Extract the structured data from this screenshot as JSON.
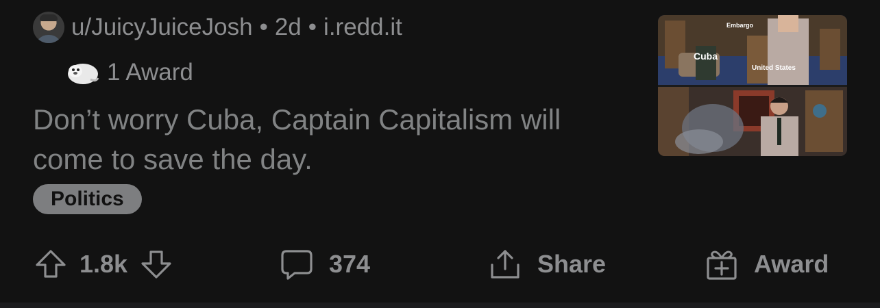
{
  "post": {
    "author": "u/JuicyJuiceJosh",
    "age": "2d",
    "domain": "i.redd.it",
    "separator": "•",
    "awards_label": "1 Award",
    "title": "Don’t worry Cuba, Captain Capitalism will come to save the day.",
    "flair": "Politics",
    "thumbnail": {
      "label_top": "Embargo",
      "label_left": "Cuba",
      "label_right": "United States"
    }
  },
  "actions": {
    "upvotes": "1.8k",
    "comments": "374",
    "share_label": "Share",
    "award_label": "Award"
  },
  "icons": {
    "upvote": "arrow-up-icon",
    "downvote": "arrow-down-icon",
    "comment": "speech-bubble-icon",
    "share": "share-icon",
    "award": "gift-icon",
    "award_badge": "seal-award-icon"
  },
  "colors": {
    "background": "#121212",
    "text": "#818384",
    "flair_bg": "#7d7e80"
  }
}
